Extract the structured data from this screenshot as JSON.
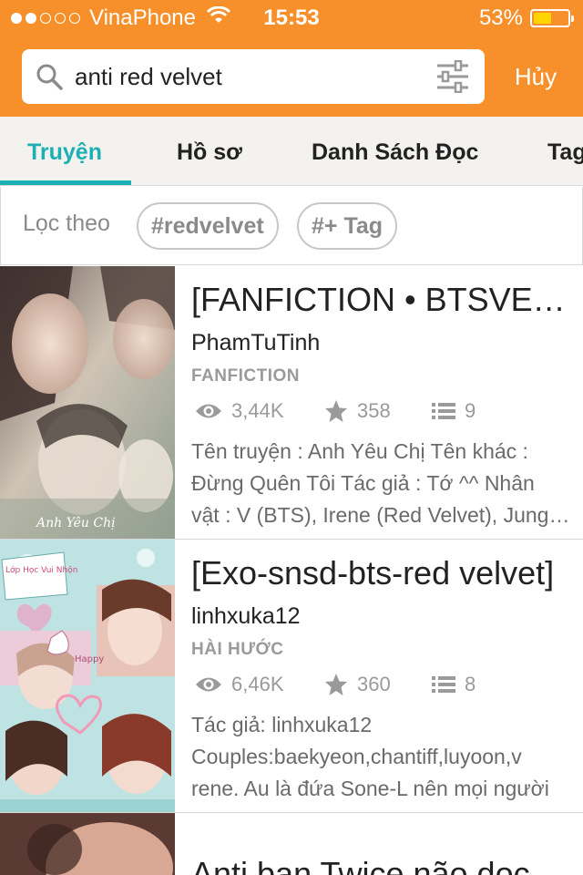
{
  "status_bar": {
    "carrier": "VinaPhone",
    "time": "15:53",
    "battery": "53%",
    "battery_level": 0.53,
    "signal_bars": 2
  },
  "search": {
    "query": "anti red velvet",
    "cancel_label": "Hủy"
  },
  "tabs": [
    {
      "label": "Truyện",
      "active": true
    },
    {
      "label": "Hồ sơ",
      "active": false
    },
    {
      "label": "Danh Sách Đọc",
      "active": false
    },
    {
      "label": "Tag",
      "active": false
    }
  ],
  "filter": {
    "label": "Lọc theo",
    "chips": [
      "#redvelvet",
      "#+ Tag"
    ]
  },
  "stories": [
    {
      "title": "[FANFICTION • BTSVELVET]",
      "author": "PhamTuTinh",
      "category": "FANFICTION",
      "views": "3,44K",
      "votes": "358",
      "parts": "9",
      "description": [
        "Tên truyện : Anh Yêu Chị Tên khác :",
        "Đừng Quên Tôi Tác giả : Tớ ^^ Nhân",
        "vật : V (BTS), Irene (Red Velvet), Jungkook"
      ],
      "cover_text": "Anh Yêu Chị"
    },
    {
      "title": "[Exo-snsd-bts-red velvet]",
      "author": "linhxuka12",
      "category": "HÀI HƯỚC",
      "views": "6,46K",
      "votes": "360",
      "parts": "8",
      "description": [
        "Tác giả: linhxuka12",
        "Couples:baekyeon,chantiff,luyoon,v",
        "rene. Au là đứa Sone-L nên mọi người"
      ],
      "cover_text_1": "Lớp Học Vui Nhộn",
      "cover_text_2": "Happy"
    },
    {
      "title": "Anti ban Twice não dọc"
    }
  ],
  "colors": {
    "header": "#f7902a",
    "accent": "#1cb0b5"
  }
}
